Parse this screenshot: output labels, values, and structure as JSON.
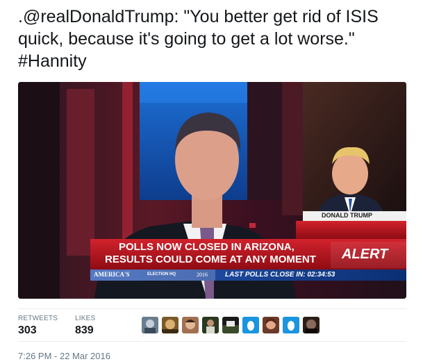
{
  "tweet": {
    "text": ".@realDonaldTrump: \"You better get rid of ISIS quick, because it's going to get a lot worse.\" #Hannity"
  },
  "media": {
    "description_icon": "video-still-icon",
    "lower_third": {
      "name_label": "DONALD TRUMP",
      "headline_line1": "POLLS NOW CLOSED IN ARIZONA,",
      "headline_line2": "RESULTS COULD COME AT ANY MOMENT",
      "alert": "ALERT",
      "ticker_brand": "AMERICA'S",
      "ticker_hq": "ELECTION HQ",
      "ticker_year": "2016",
      "ticker_polls": "LAST POLLS CLOSE IN: 02:34:53"
    }
  },
  "stats": {
    "retweets_label": "RETWEETS",
    "retweets_value": "303",
    "likes_label": "LIKES",
    "likes_value": "839"
  },
  "liked_by": [
    {
      "icon": "avatar-icon"
    },
    {
      "icon": "avatar-icon"
    },
    {
      "icon": "avatar-icon"
    },
    {
      "icon": "avatar-icon"
    },
    {
      "icon": "avatar-icon"
    },
    {
      "icon": "default-egg-avatar-icon"
    },
    {
      "icon": "avatar-icon"
    },
    {
      "icon": "default-egg-avatar-icon"
    },
    {
      "icon": "avatar-icon"
    }
  ],
  "timestamp": "7:26 PM - 22 Mar 2016",
  "colors": {
    "text": "#14171a",
    "muted": "#657786",
    "border": "#e6ecf0",
    "fox_red": "#b5121b",
    "fox_blue": "#0a3d8f",
    "egg_blue": "#1b95e0"
  }
}
